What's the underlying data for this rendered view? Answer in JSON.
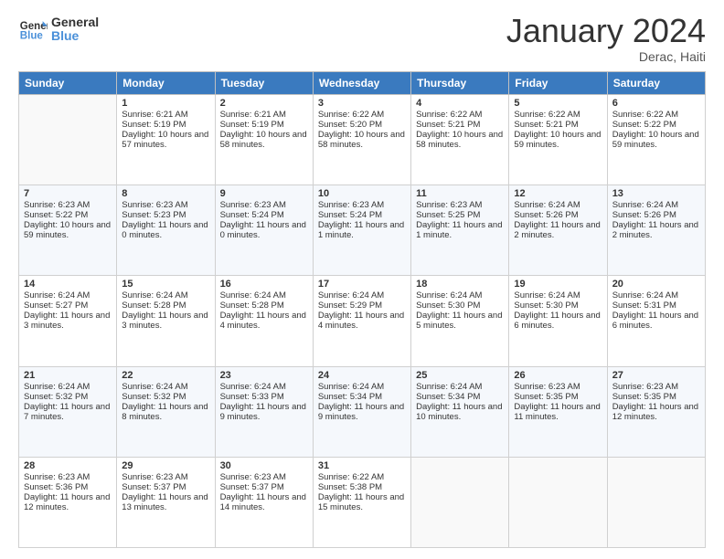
{
  "logo": {
    "line1": "General",
    "line2": "Blue"
  },
  "title": "January 2024",
  "location": "Derac, Haiti",
  "days_of_week": [
    "Sunday",
    "Monday",
    "Tuesday",
    "Wednesday",
    "Thursday",
    "Friday",
    "Saturday"
  ],
  "weeks": [
    [
      {
        "day": "",
        "sunrise": "",
        "sunset": "",
        "daylight": ""
      },
      {
        "day": "1",
        "sunrise": "Sunrise: 6:21 AM",
        "sunset": "Sunset: 5:19 PM",
        "daylight": "Daylight: 10 hours and 57 minutes."
      },
      {
        "day": "2",
        "sunrise": "Sunrise: 6:21 AM",
        "sunset": "Sunset: 5:19 PM",
        "daylight": "Daylight: 10 hours and 58 minutes."
      },
      {
        "day": "3",
        "sunrise": "Sunrise: 6:22 AM",
        "sunset": "Sunset: 5:20 PM",
        "daylight": "Daylight: 10 hours and 58 minutes."
      },
      {
        "day": "4",
        "sunrise": "Sunrise: 6:22 AM",
        "sunset": "Sunset: 5:21 PM",
        "daylight": "Daylight: 10 hours and 58 minutes."
      },
      {
        "day": "5",
        "sunrise": "Sunrise: 6:22 AM",
        "sunset": "Sunset: 5:21 PM",
        "daylight": "Daylight: 10 hours and 59 minutes."
      },
      {
        "day": "6",
        "sunrise": "Sunrise: 6:22 AM",
        "sunset": "Sunset: 5:22 PM",
        "daylight": "Daylight: 10 hours and 59 minutes."
      }
    ],
    [
      {
        "day": "7",
        "sunrise": "Sunrise: 6:23 AM",
        "sunset": "Sunset: 5:22 PM",
        "daylight": "Daylight: 10 hours and 59 minutes."
      },
      {
        "day": "8",
        "sunrise": "Sunrise: 6:23 AM",
        "sunset": "Sunset: 5:23 PM",
        "daylight": "Daylight: 11 hours and 0 minutes."
      },
      {
        "day": "9",
        "sunrise": "Sunrise: 6:23 AM",
        "sunset": "Sunset: 5:24 PM",
        "daylight": "Daylight: 11 hours and 0 minutes."
      },
      {
        "day": "10",
        "sunrise": "Sunrise: 6:23 AM",
        "sunset": "Sunset: 5:24 PM",
        "daylight": "Daylight: 11 hours and 1 minute."
      },
      {
        "day": "11",
        "sunrise": "Sunrise: 6:23 AM",
        "sunset": "Sunset: 5:25 PM",
        "daylight": "Daylight: 11 hours and 1 minute."
      },
      {
        "day": "12",
        "sunrise": "Sunrise: 6:24 AM",
        "sunset": "Sunset: 5:26 PM",
        "daylight": "Daylight: 11 hours and 2 minutes."
      },
      {
        "day": "13",
        "sunrise": "Sunrise: 6:24 AM",
        "sunset": "Sunset: 5:26 PM",
        "daylight": "Daylight: 11 hours and 2 minutes."
      }
    ],
    [
      {
        "day": "14",
        "sunrise": "Sunrise: 6:24 AM",
        "sunset": "Sunset: 5:27 PM",
        "daylight": "Daylight: 11 hours and 3 minutes."
      },
      {
        "day": "15",
        "sunrise": "Sunrise: 6:24 AM",
        "sunset": "Sunset: 5:28 PM",
        "daylight": "Daylight: 11 hours and 3 minutes."
      },
      {
        "day": "16",
        "sunrise": "Sunrise: 6:24 AM",
        "sunset": "Sunset: 5:28 PM",
        "daylight": "Daylight: 11 hours and 4 minutes."
      },
      {
        "day": "17",
        "sunrise": "Sunrise: 6:24 AM",
        "sunset": "Sunset: 5:29 PM",
        "daylight": "Daylight: 11 hours and 4 minutes."
      },
      {
        "day": "18",
        "sunrise": "Sunrise: 6:24 AM",
        "sunset": "Sunset: 5:30 PM",
        "daylight": "Daylight: 11 hours and 5 minutes."
      },
      {
        "day": "19",
        "sunrise": "Sunrise: 6:24 AM",
        "sunset": "Sunset: 5:30 PM",
        "daylight": "Daylight: 11 hours and 6 minutes."
      },
      {
        "day": "20",
        "sunrise": "Sunrise: 6:24 AM",
        "sunset": "Sunset: 5:31 PM",
        "daylight": "Daylight: 11 hours and 6 minutes."
      }
    ],
    [
      {
        "day": "21",
        "sunrise": "Sunrise: 6:24 AM",
        "sunset": "Sunset: 5:32 PM",
        "daylight": "Daylight: 11 hours and 7 minutes."
      },
      {
        "day": "22",
        "sunrise": "Sunrise: 6:24 AM",
        "sunset": "Sunset: 5:32 PM",
        "daylight": "Daylight: 11 hours and 8 minutes."
      },
      {
        "day": "23",
        "sunrise": "Sunrise: 6:24 AM",
        "sunset": "Sunset: 5:33 PM",
        "daylight": "Daylight: 11 hours and 9 minutes."
      },
      {
        "day": "24",
        "sunrise": "Sunrise: 6:24 AM",
        "sunset": "Sunset: 5:34 PM",
        "daylight": "Daylight: 11 hours and 9 minutes."
      },
      {
        "day": "25",
        "sunrise": "Sunrise: 6:24 AM",
        "sunset": "Sunset: 5:34 PM",
        "daylight": "Daylight: 11 hours and 10 minutes."
      },
      {
        "day": "26",
        "sunrise": "Sunrise: 6:23 AM",
        "sunset": "Sunset: 5:35 PM",
        "daylight": "Daylight: 11 hours and 11 minutes."
      },
      {
        "day": "27",
        "sunrise": "Sunrise: 6:23 AM",
        "sunset": "Sunset: 5:35 PM",
        "daylight": "Daylight: 11 hours and 12 minutes."
      }
    ],
    [
      {
        "day": "28",
        "sunrise": "Sunrise: 6:23 AM",
        "sunset": "Sunset: 5:36 PM",
        "daylight": "Daylight: 11 hours and 12 minutes."
      },
      {
        "day": "29",
        "sunrise": "Sunrise: 6:23 AM",
        "sunset": "Sunset: 5:37 PM",
        "daylight": "Daylight: 11 hours and 13 minutes."
      },
      {
        "day": "30",
        "sunrise": "Sunrise: 6:23 AM",
        "sunset": "Sunset: 5:37 PM",
        "daylight": "Daylight: 11 hours and 14 minutes."
      },
      {
        "day": "31",
        "sunrise": "Sunrise: 6:22 AM",
        "sunset": "Sunset: 5:38 PM",
        "daylight": "Daylight: 11 hours and 15 minutes."
      },
      {
        "day": "",
        "sunrise": "",
        "sunset": "",
        "daylight": ""
      },
      {
        "day": "",
        "sunrise": "",
        "sunset": "",
        "daylight": ""
      },
      {
        "day": "",
        "sunrise": "",
        "sunset": "",
        "daylight": ""
      }
    ]
  ]
}
